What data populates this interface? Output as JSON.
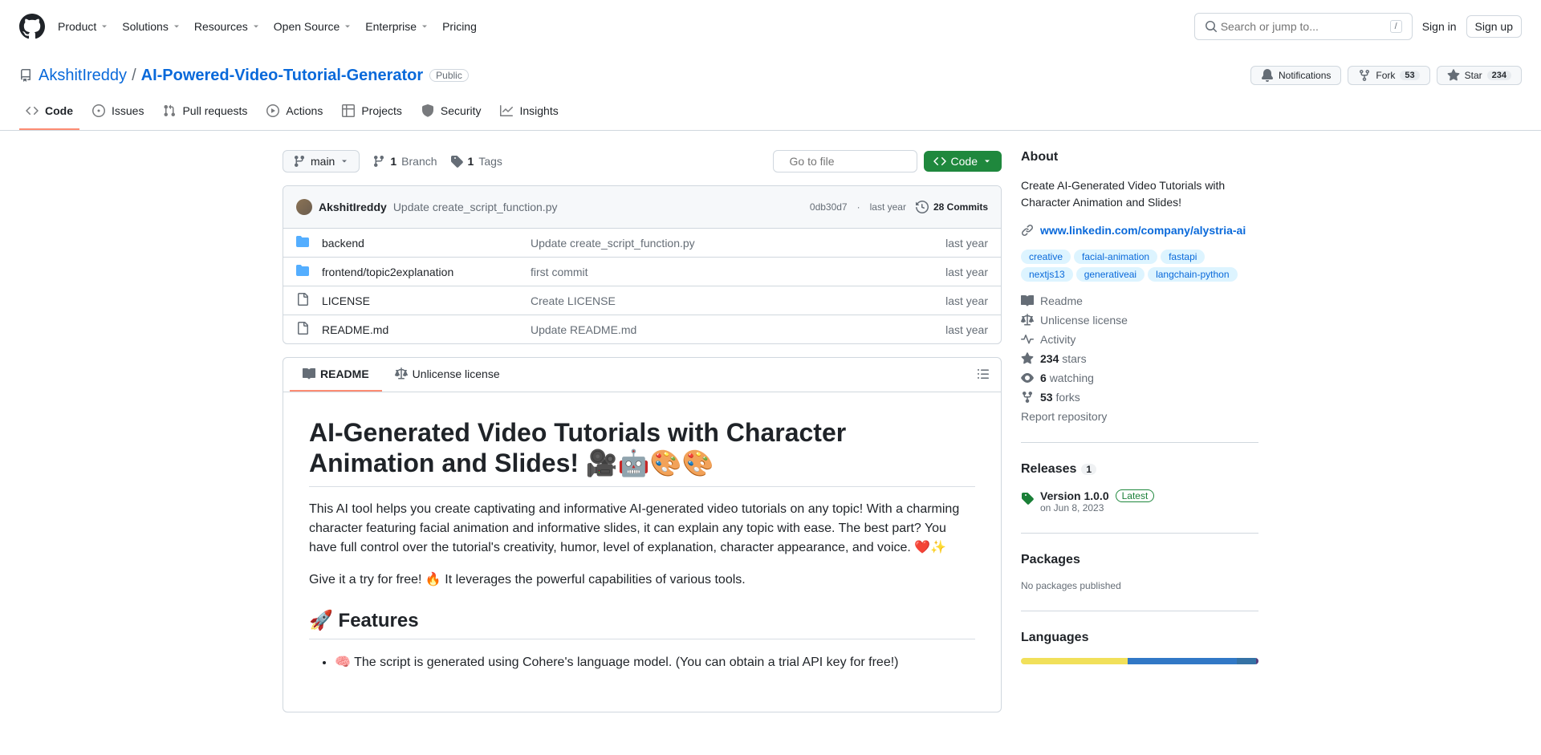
{
  "header": {
    "nav": [
      "Product",
      "Solutions",
      "Resources",
      "Open Source",
      "Enterprise",
      "Pricing"
    ],
    "search_placeholder": "Search or jump to...",
    "search_kbd": "/",
    "sign_in": "Sign in",
    "sign_up": "Sign up"
  },
  "repo": {
    "owner": "AkshitIreddy",
    "name": "AI-Powered-Video-Tutorial-Generator",
    "visibility": "Public",
    "actions": {
      "notifications": "Notifications",
      "fork": "Fork",
      "fork_count": "53",
      "star": "Star",
      "star_count": "234"
    },
    "tabs": [
      "Code",
      "Issues",
      "Pull requests",
      "Actions",
      "Projects",
      "Security",
      "Insights"
    ]
  },
  "branch": {
    "name": "main",
    "branch_count": "1",
    "branch_label": "Branch",
    "tag_count": "1",
    "tag_label": "Tags"
  },
  "file_search_placeholder": "Go to file",
  "code_button": "Code",
  "commit": {
    "author": "AkshitIreddy",
    "message": "Update create_script_function.py",
    "sha": "0db30d7",
    "date": "last year",
    "count_text": "28 Commits"
  },
  "files": [
    {
      "type": "dir",
      "name": "backend",
      "msg": "Update create_script_function.py",
      "date": "last year"
    },
    {
      "type": "dir",
      "name": "frontend/topic2explanation",
      "msg": "first commit",
      "date": "last year"
    },
    {
      "type": "file",
      "name": "LICENSE",
      "msg": "Create LICENSE",
      "date": "last year"
    },
    {
      "type": "file",
      "name": "README.md",
      "msg": "Update README.md",
      "date": "last year"
    }
  ],
  "readme_tabs": {
    "readme": "README",
    "license": "Unlicense license"
  },
  "readme": {
    "title": "AI-Generated Video Tutorials with Character Animation and Slides! 🎥🤖🎨🎨",
    "p1": "This AI tool helps you create captivating and informative AI-generated video tutorials on any topic! With a charming character featuring facial animation and informative slides, it can explain any topic with ease. The best part? You have full control over the tutorial's creativity, humor, level of explanation, character appearance, and voice. ❤️✨",
    "p2": "Give it a try for free! 🔥 It leverages the powerful capabilities of various tools.",
    "h2": "🚀 Features",
    "li1": "🧠 The script is generated using Cohere's language model. (You can obtain a trial API key for free!)"
  },
  "about": {
    "heading": "About",
    "description": "Create AI-Generated Video Tutorials with Character Animation and Slides!",
    "link": "www.linkedin.com/company/alystria-ai",
    "topics": [
      "creative",
      "facial-animation",
      "fastapi",
      "nextjs13",
      "generativeai",
      "langchain-python"
    ],
    "meta": {
      "readme": "Readme",
      "license": "Unlicense license",
      "activity": "Activity",
      "stars_count": "234",
      "stars_label": "stars",
      "watching_count": "6",
      "watching_label": "watching",
      "forks_count": "53",
      "forks_label": "forks",
      "report": "Report repository"
    }
  },
  "releases": {
    "heading": "Releases",
    "count": "1",
    "version": "Version 1.0.0",
    "latest_badge": "Latest",
    "date": "on Jun 8, 2023"
  },
  "packages": {
    "heading": "Packages",
    "none": "No packages published"
  },
  "languages": {
    "heading": "Languages",
    "segments": [
      {
        "color": "#f1e05a",
        "pct": 45
      },
      {
        "color": "#3178c6",
        "pct": 46
      },
      {
        "color": "#3572A5",
        "pct": 8
      },
      {
        "color": "#563d7c",
        "pct": 1
      }
    ]
  }
}
